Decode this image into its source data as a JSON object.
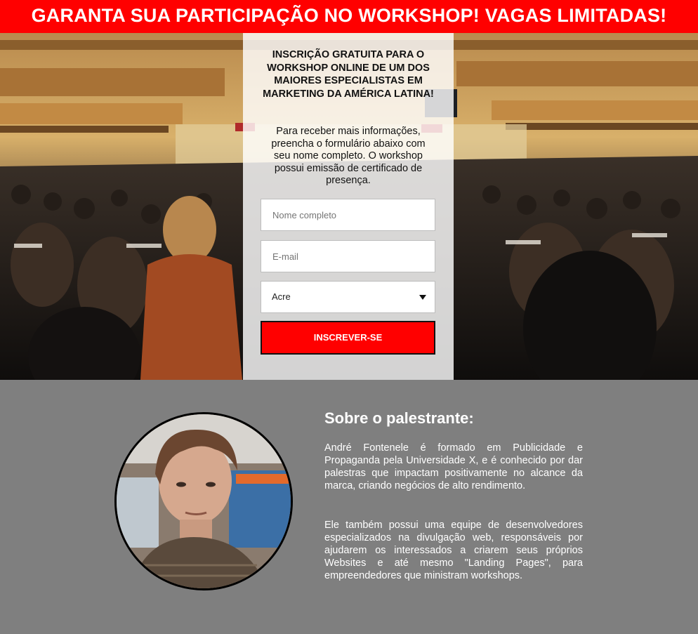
{
  "banner": {
    "text": "GARANTA SUA PARTICIPAÇÃO NO WORKSHOP! VAGAS LIMITADAS!",
    "color": "#ff0000"
  },
  "form": {
    "title": "INSCRIÇÃO GRATUITA PARA O WORKSHOP ONLINE DE UM DOS MAIORES ESPECIALISTAS EM MARKETING DA AMÉRICA LATINA!",
    "description": "Para receber mais informações, preencha o formulário abaixo com seu nome completo. O workshop possui emissão de certificado de presença.",
    "name_placeholder": "Nome completo",
    "email_placeholder": "E-mail",
    "state_selected": "Acre",
    "submit_label": "INSCREVER-SE",
    "submit_color": "#ff0000"
  },
  "about": {
    "title": "Sobre o palestrante:",
    "paragraph1": "André Fontenele é formado em Publicidade e Propaganda pela Universidade X, e é conhecido por dar palestras que impactam positivamente no alcance da marca, criando negócios de alto rendimento.",
    "paragraph2": "Ele também possui uma equipe de desenvolvedores especializados na divulgação web, responsáveis por ajudarem os interessados a criarem seus próprios Websites e até mesmo \"Landing Pages\", para empreendedores que ministram workshops.",
    "background_color": "#7f7f7f"
  }
}
